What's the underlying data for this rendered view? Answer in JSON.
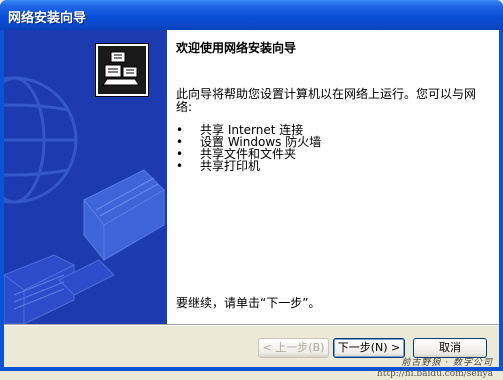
{
  "window": {
    "title": "网络安装向导"
  },
  "content": {
    "heading": "欢迎使用网络安装向导",
    "description": "此向导将帮助您设置计算机以在网络上运行。您可以与网络:",
    "bullet_symbol": "•",
    "items": [
      "共享 Internet 连接",
      "设置 Windows 防火墙",
      "共享文件和文件夹",
      "共享打印机"
    ],
    "continue_text": "要继续，请单击“下一步”。"
  },
  "buttons": {
    "back": "< 上一步(B)",
    "next": "下一步(N) >",
    "cancel": "取消"
  },
  "watermark": {
    "signature": "前古野狼 · 数字公司",
    "url": "http://hi.baidu.com/senya"
  },
  "colors": {
    "titlebar": "#0a4fd8",
    "left_panel": "#1c3bb0",
    "dialog_bg": "#ece9d8"
  },
  "icons": {
    "wizard": "network-computers-icon"
  }
}
